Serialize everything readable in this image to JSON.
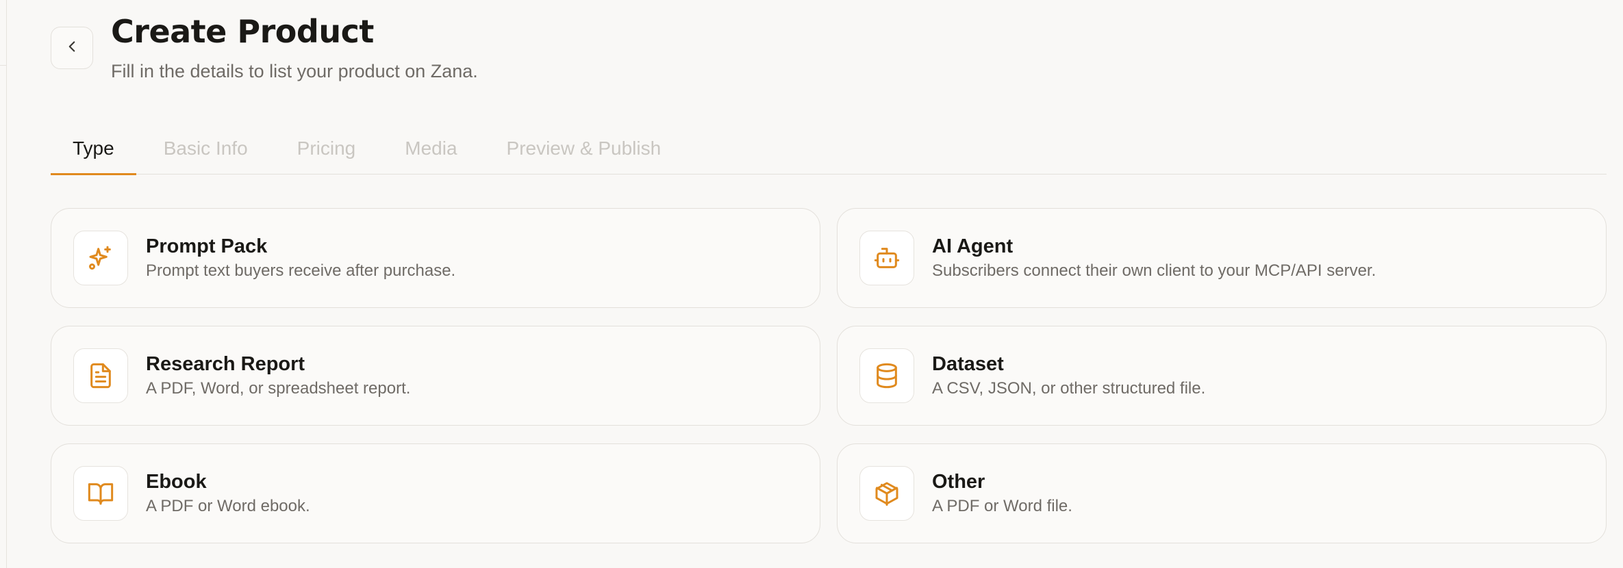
{
  "header": {
    "title": "Create Product",
    "subtitle": "Fill in the details to list your product on Zana."
  },
  "tabs": [
    {
      "label": "Type",
      "active": true
    },
    {
      "label": "Basic Info",
      "active": false
    },
    {
      "label": "Pricing",
      "active": false
    },
    {
      "label": "Media",
      "active": false
    },
    {
      "label": "Preview & Publish",
      "active": false
    }
  ],
  "product_types": [
    {
      "title": "Prompt Pack",
      "description": "Prompt text buyers receive after purchase.",
      "icon": "sparkles-icon"
    },
    {
      "title": "AI Agent",
      "description": "Subscribers connect their own client to your MCP/API server.",
      "icon": "bot-icon"
    },
    {
      "title": "Research Report",
      "description": "A PDF, Word, or spreadsheet report.",
      "icon": "file-text-icon"
    },
    {
      "title": "Dataset",
      "description": "A CSV, JSON, or other structured file.",
      "icon": "database-icon"
    },
    {
      "title": "Ebook",
      "description": "A PDF or Word ebook.",
      "icon": "book-open-icon"
    },
    {
      "title": "Other",
      "description": "A PDF or Word file.",
      "icon": "package-icon"
    }
  ],
  "colors": {
    "accent": "#e08a1e",
    "background": "#f9f8f6",
    "border": "#e3e0db",
    "muted_text": "#6f6b66",
    "disabled_tab": "#c9c6c1"
  }
}
